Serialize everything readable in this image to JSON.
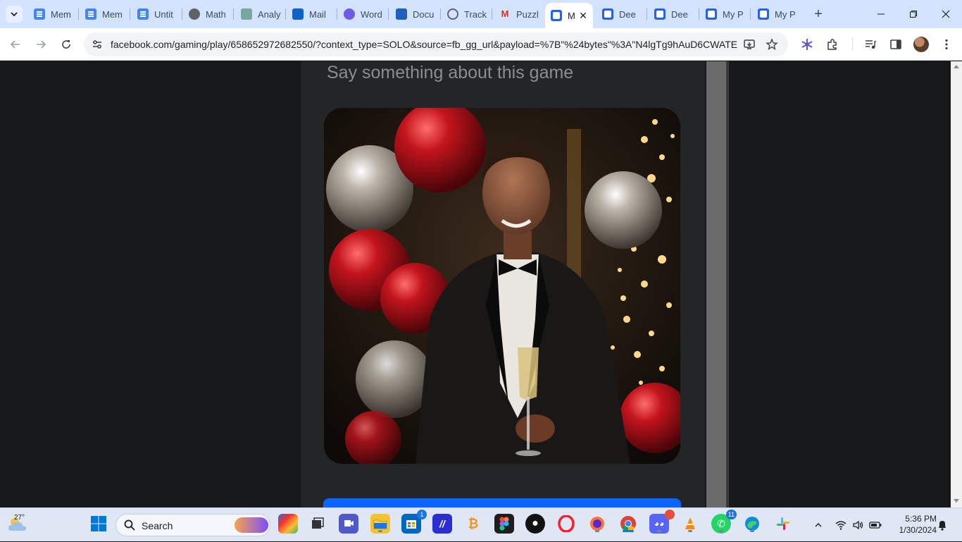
{
  "tabs": [
    {
      "label": "Mem",
      "icon": "google-docs-icon",
      "fav": "fav-docs"
    },
    {
      "label": "Mem",
      "icon": "google-docs-icon",
      "fav": "fav-docs"
    },
    {
      "label": "Untit",
      "icon": "google-docs-icon",
      "fav": "fav-docs"
    },
    {
      "label": "Math",
      "icon": "globe-icon",
      "fav": "fav-globe"
    },
    {
      "label": "Analy",
      "icon": "analysis-icon",
      "fav": "fav-analy"
    },
    {
      "label": "Mail",
      "icon": "outlook-icon",
      "fav": "fav-outlook"
    },
    {
      "label": "Word",
      "icon": "wordtune-icon",
      "fav": "fav-word2"
    },
    {
      "label": "Docu",
      "icon": "word-icon",
      "fav": "fav-word"
    },
    {
      "label": "Track",
      "icon": "tracker-icon",
      "fav": "fav-track"
    },
    {
      "label": "Puzzl",
      "icon": "gmail-icon",
      "fav": "fav-gmail"
    },
    {
      "label": "M",
      "icon": "facebook-gaming-icon",
      "fav": "fav-dee",
      "active": true
    },
    {
      "label": "Dee",
      "icon": "deepl-icon",
      "fav": "fav-dee"
    },
    {
      "label": "Dee",
      "icon": "deepl-icon",
      "fav": "fav-dee"
    },
    {
      "label": "My P",
      "icon": "deepl-icon",
      "fav": "fav-dee"
    },
    {
      "label": "My P",
      "icon": "deepl-icon",
      "fav": "fav-dee"
    }
  ],
  "toolbar": {
    "url": "facebook.com/gaming/play/658652972682550/?context_type=SOLO&source=fb_gg_url&payload=%7B\"%24bytes\"%3A\"N4lgTg9hAuD6CWATE..."
  },
  "page": {
    "comment_placeholder": "Say something about this game",
    "game_image_description": "man-in-tuxedo-with-champagne"
  },
  "taskbar": {
    "weather_temp": "27°",
    "search_label": "Search",
    "teams_badge": "1",
    "whatsapp_badge": "11",
    "time": "5:36 PM",
    "date": "1/30/2024"
  },
  "colors": {
    "accent": "#0866ff",
    "tab_strip": "#d3e3fd",
    "page_background": "#18191a",
    "dialog_background": "#242526"
  }
}
